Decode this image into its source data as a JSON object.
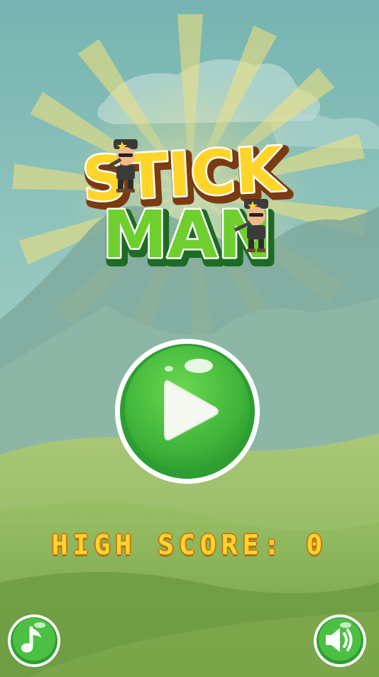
{
  "game": {
    "title_line1": "STICK",
    "title_line2": "MAN",
    "high_score_label": "HIGH SCORE:",
    "high_score_value": "0"
  },
  "buttons": {
    "play_icon": "play-icon",
    "music_icon": "music-note-icon",
    "sound_icon": "speaker-icon"
  },
  "colors": {
    "sky_top": "#79b7b4",
    "sky_bottom": "#9cccc1",
    "mountain": "#7ea9a0",
    "hills": "#8fb561",
    "title_yellow": "#ffd52a",
    "title_green": "#6fcf2e",
    "button_green": "#46b83c",
    "score_yellow": "#ffd52a"
  }
}
